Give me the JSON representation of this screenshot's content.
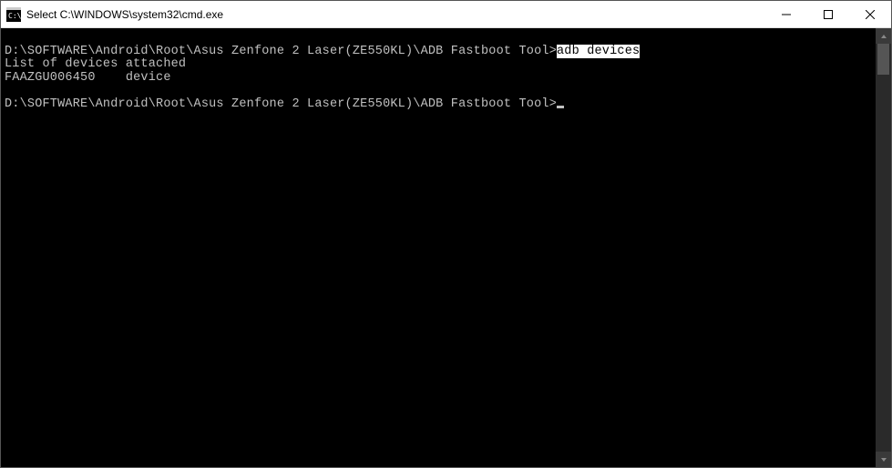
{
  "window": {
    "title": "Select C:\\WINDOWS\\system32\\cmd.exe"
  },
  "terminal": {
    "prompt1": "D:\\SOFTWARE\\Android\\Root\\Asus Zenfone 2 Laser(ZE550KL)\\ADB Fastboot Tool>",
    "command1_selected": "adb devices",
    "output_line1": "List of devices attached",
    "output_line2": "FAAZGU006450    device",
    "blank": "",
    "prompt2": "D:\\SOFTWARE\\Android\\Root\\Asus Zenfone 2 Laser(ZE550KL)\\ADB Fastboot Tool>"
  }
}
